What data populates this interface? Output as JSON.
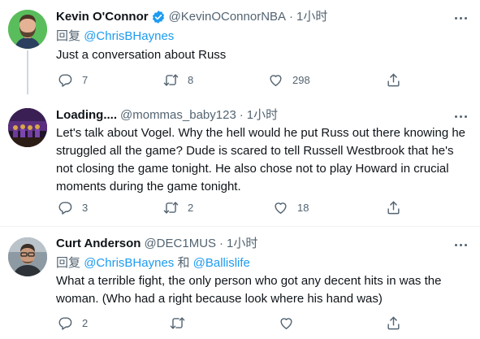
{
  "tweets": [
    {
      "name": "Kevin O'Connor",
      "verified": true,
      "handle": "@KevinOConnorNBA",
      "sep": "·",
      "time": "1小时",
      "reply_prefix": "回复",
      "reply_to": [
        "@ChrisBHaynes"
      ],
      "text": "Just a conversation about Russ",
      "reply_count": "7",
      "retweet_count": "8",
      "like_count": "298"
    },
    {
      "name": "Loading....",
      "verified": false,
      "handle": "@mommas_baby123",
      "sep": "·",
      "time": "1小时",
      "text": "Let's talk about Vogel. Why the hell would he put Russ out there knowing he struggled all the game? Dude is scared to tell Russell Westbrook that he's not closing the game tonight. He also chose not to play Howard in crucial moments during the game tonight.",
      "reply_count": "3",
      "retweet_count": "2",
      "like_count": "18"
    },
    {
      "name": "Curt Anderson",
      "verified": false,
      "handle": "@DEC1MUS",
      "sep": "·",
      "time": "1小时",
      "reply_prefix": "回复",
      "reply_to": [
        "@ChrisBHaynes",
        "@Ballislife"
      ],
      "reply_joiner": "和",
      "text": "What a terrible fight, the only person who got any decent hits in was the woman. (Who had a right because look where his hand was)",
      "reply_count": "2",
      "retweet_count": "",
      "like_count": ""
    }
  ],
  "colors": {
    "link": "#1d9bf0",
    "muted": "#536471",
    "divider": "#eff3f4"
  },
  "icons": [
    "verified-badge-icon",
    "more-icon",
    "reply-icon",
    "retweet-icon",
    "like-icon",
    "share-icon"
  ]
}
